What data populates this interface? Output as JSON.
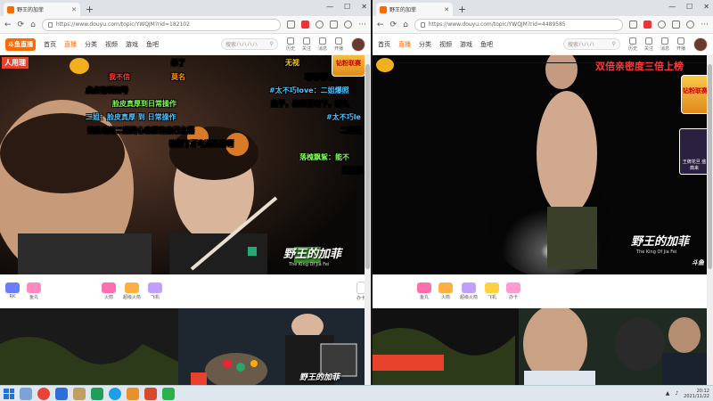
{
  "left": {
    "tab_title": "野王的加菲",
    "url": "https://www.douyu.com/topic/YWQJM?rid=182102",
    "logo": "斗鱼直播",
    "nav": [
      "首页",
      "直播",
      "分类",
      "视频",
      "游戏",
      "鱼吧"
    ],
    "search_placeholder": "搜索ハハハハ",
    "nav_icons": [
      "历史",
      "关注",
      "消息",
      "开播"
    ],
    "danmaku": [
      {
        "text": "杀了",
        "color": "#ffffff"
      },
      {
        "text": "无视",
        "color": "#ffcc00"
      },
      {
        "text": "我不信",
        "color": "#ff3b3b"
      },
      {
        "text": "莫名",
        "color": "#ff8c00"
      },
      {
        "text": "哈哈哈哈",
        "color": "#ffffff"
      },
      {
        "text": "点点有新加号",
        "color": "#ffffff"
      },
      {
        "text": "#太不巧love：二姐爆照",
        "color": "#4fc3ff"
      },
      {
        "text": "脸皮真厚到日常操作",
        "color": "#7cff4f"
      },
      {
        "text": "盒子，出来互动下，好久",
        "color": "#ffffff"
      },
      {
        "text": "二姐：脸皮真厚 到 日常操作",
        "color": "#4fc3ff"
      },
      {
        "text": "#太不巧le",
        "color": "#4fc3ff"
      },
      {
        "text": "说实话有二姐的心态就有自己主播",
        "color": "#ffffff"
      },
      {
        "text": "二姐是",
        "color": "#ffffff"
      },
      {
        "text": "被封了还在送礼物啊",
        "color": "#ffffff"
      },
      {
        "text": "落槐飘絮：能不",
        "color": "#7cff4f"
      },
      {
        "text": "落槐飘",
        "color": "#ffffff"
      }
    ],
    "watermark": "野王的加菲",
    "watermark_sub": "The King Of Jia Fei",
    "corner_badge": "人用理",
    "promo": "钻粉联赛",
    "gifts": [
      "RK",
      "鱼丸",
      "火箭",
      "超级火箭",
      "飞机",
      "办卡"
    ]
  },
  "right": {
    "tab_title": "野王的加菲",
    "url": "https://www.douyu.com/topic/YWQJM?rid=4489585",
    "nav": [
      "首页",
      "直播",
      "分类",
      "视频",
      "游戏",
      "鱼吧"
    ],
    "search_placeholder": "搜索ハハハ",
    "nav_icons": [
      "历史",
      "关注",
      "消息",
      "开播"
    ],
    "banner": "双倍亲密度三倍上榜",
    "watermark": "野王的加菲",
    "watermark_sub": "The King Of Jia Fei",
    "douyu_mark": "斗鱼",
    "promo": "钻粉联赛",
    "promo_card": "王牌花旦 盛典来",
    "gifts": [
      "鱼丸",
      "火箭",
      "超级火箭",
      "飞机",
      "办卡"
    ],
    "bottom_wm": "野王的加菲"
  },
  "taskbar": {
    "time": "20:12",
    "date": "2021/11/22",
    "apps": [
      "ie-icon",
      "chrome-icon",
      "media-icon",
      "edge-icon",
      "folder-icon",
      "wechat-icon"
    ]
  }
}
